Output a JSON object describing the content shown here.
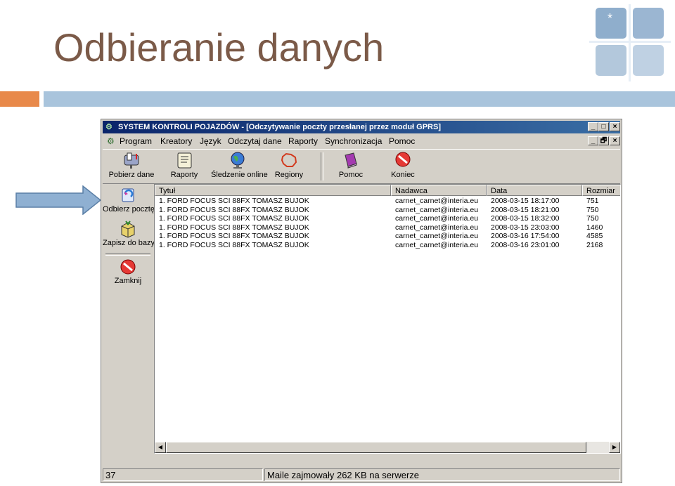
{
  "slide": {
    "title": "Odbieranie danych",
    "logo_star": "*"
  },
  "window": {
    "title": "SYSTEM KONTROLI POJAZDÓW - [Odczytywanie poczty przesłanej przez moduł GPRS]",
    "controls": {
      "minimize": "_",
      "maximize": "□",
      "close": "×",
      "mdi_restore": "🗗"
    },
    "menu": [
      "Program",
      "Kreatory",
      "Język",
      "Odczytaj dane",
      "Raporty",
      "Synchronizacja",
      "Pomoc"
    ],
    "toolbar": [
      {
        "label": "Pobierz dane",
        "icon": "mailbox-icon"
      },
      {
        "label": "Raporty",
        "icon": "scroll-icon"
      },
      {
        "label": "Śledzenie online",
        "icon": "globe-icon"
      },
      {
        "label": "Regiony",
        "icon": "map-outline-icon"
      },
      {
        "label": "Pomoc",
        "icon": "help-book-icon"
      },
      {
        "label": "Koniec",
        "icon": "stop-icon"
      }
    ],
    "side_actions": [
      {
        "label": "Odbierz pocztę",
        "icon": "receive-mail-icon"
      },
      {
        "label": "Zapisz do bazy",
        "icon": "box-icon"
      },
      {
        "label": "Zamknij",
        "icon": "stop-icon"
      }
    ],
    "table": {
      "columns": [
        "Tytuł",
        "Nadawca",
        "Data",
        "Rozmiar"
      ],
      "rows": [
        [
          "1. FORD FOCUS SCI 88FX TOMASZ BUJOK",
          "carnet_carnet@interia.eu",
          "2008-03-15 18:17:00",
          "751"
        ],
        [
          "1. FORD FOCUS SCI 88FX TOMASZ BUJOK",
          "carnet_carnet@interia.eu",
          "2008-03-15 18:21:00",
          "750"
        ],
        [
          "1. FORD FOCUS SCI 88FX TOMASZ BUJOK",
          "carnet_carnet@interia.eu",
          "2008-03-15 18:32:00",
          "750"
        ],
        [
          "1. FORD FOCUS SCI 88FX TOMASZ BUJOK",
          "carnet_carnet@interia.eu",
          "2008-03-15 23:03:00",
          "1460"
        ],
        [
          "1. FORD FOCUS SCI 88FX TOMASZ BUJOK",
          "carnet_carnet@interia.eu",
          "2008-03-16 17:54:00",
          "4585"
        ],
        [
          "1. FORD FOCUS SCI 88FX TOMASZ BUJOK",
          "carnet_carnet@interia.eu",
          "2008-03-16 23:01:00",
          "2168"
        ]
      ]
    },
    "status": {
      "count": "37",
      "message": "Maile zajmowały 262 KB na serwerze"
    }
  },
  "colors": {
    "title_text": "#7b5a48",
    "accent_orange": "#e8894a",
    "accent_blue": "#a9c4dc",
    "window_face": "#d4d0c8",
    "titlebar_start": "#0a246a",
    "titlebar_end": "#3a6ea5"
  }
}
